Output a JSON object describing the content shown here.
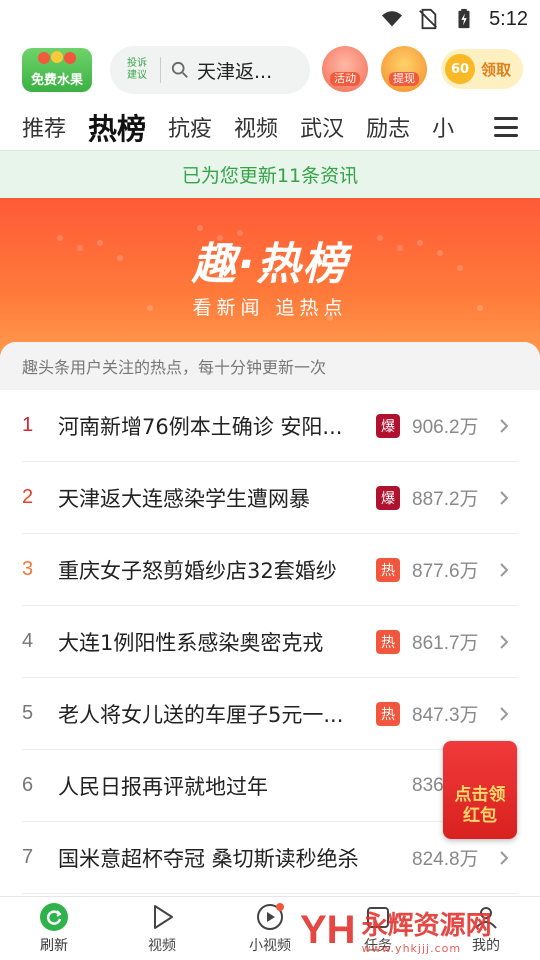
{
  "status_bar": {
    "time": "5:12"
  },
  "header": {
    "logo_label": "免费水果",
    "complaint_label": "投诉建议",
    "search_text": "天津返...",
    "activity_label": "活动",
    "withdraw_label": "提现",
    "coin_value": "60",
    "coin_label": "领取"
  },
  "tabs": [
    {
      "label": "推荐",
      "active": false
    },
    {
      "label": "热榜",
      "active": true
    },
    {
      "label": "抗疫",
      "active": false
    },
    {
      "label": "视频",
      "active": false
    },
    {
      "label": "武汉",
      "active": false
    },
    {
      "label": "励志",
      "active": false
    },
    {
      "label": "小",
      "active": false
    }
  ],
  "update_notice": "已为您更新11条资讯",
  "hero": {
    "title": "趣·热榜",
    "subtitle": "看新闻 追热点"
  },
  "panel_note": "趣头条用户关注的热点，每十分钟更新一次",
  "ranking": [
    {
      "rank": "1",
      "title": "河南新增76例本土确诊 安阳...",
      "badge": "爆",
      "badge_type": "bao",
      "heat": "906.2万",
      "color": "#d8252b"
    },
    {
      "rank": "2",
      "title": "天津返大连感染学生遭网暴",
      "badge": "爆",
      "badge_type": "bao",
      "heat": "887.2万",
      "color": "#e8402b"
    },
    {
      "rank": "3",
      "title": "重庆女子怒剪婚纱店32套婚纱",
      "badge": "热",
      "badge_type": "re",
      "heat": "877.6万",
      "color": "#f07a3a"
    },
    {
      "rank": "4",
      "title": "大连1例阳性系感染奥密克戎",
      "badge": "热",
      "badge_type": "re",
      "heat": "861.7万",
      "color": "#777777"
    },
    {
      "rank": "5",
      "title": "老人将女儿送的车厘子5元一...",
      "badge": "热",
      "badge_type": "re",
      "heat": "847.3万",
      "color": "#777777"
    },
    {
      "rank": "6",
      "title": "人民日报再评就地过年",
      "badge": "",
      "badge_type": "none",
      "heat": "836",
      "color": "#777777"
    },
    {
      "rank": "7",
      "title": "国米意超杯夺冠 桑切斯读秒绝杀",
      "badge": "",
      "badge_type": "none",
      "heat": "824.8万",
      "color": "#777777"
    }
  ],
  "red_packet": {
    "label": "点击领红包"
  },
  "bottom_nav": [
    {
      "label": "刷新",
      "icon": "refresh-icon",
      "active": true
    },
    {
      "label": "视频",
      "icon": "play-icon",
      "active": false
    },
    {
      "label": "小视频",
      "icon": "small-video-icon",
      "active": false
    },
    {
      "label": "任务",
      "icon": "task-icon",
      "active": false
    },
    {
      "label": "我的",
      "icon": "profile-icon",
      "active": false
    }
  ],
  "watermark": {
    "logo": "YH",
    "name": "永辉资源网",
    "url": "www.yhkjjj.com"
  },
  "colors": {
    "brand_green": "#3aa64a",
    "hot_red": "#f2563c",
    "explode_red": "#b0112f"
  }
}
